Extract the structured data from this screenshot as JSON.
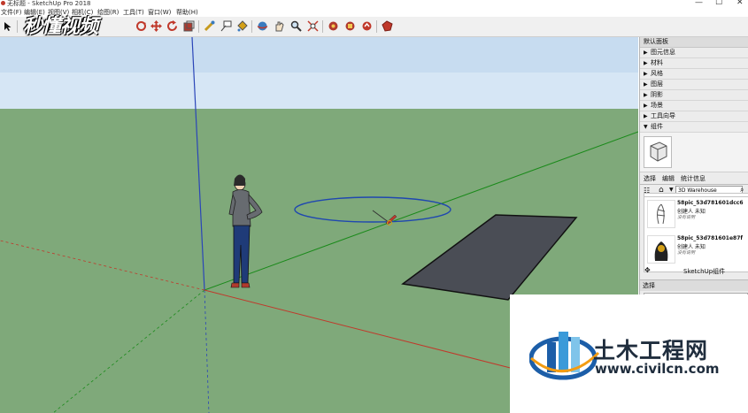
{
  "window": {
    "title": "无标题 - SketchUp Pro 2018",
    "controls": [
      "—",
      "☐",
      "✕"
    ]
  },
  "menu": [
    "文件(F)",
    "编辑(E)",
    "视图(V)",
    "相机(C)",
    "绘图(R)",
    "工具(T)",
    "窗口(W)",
    "帮助(H)"
  ],
  "watermark": "秒懂视频",
  "panel": {
    "title": "默认面板",
    "trays": [
      "图元信息",
      "材料",
      "风格",
      "图层",
      "阴影",
      "场景",
      "工具向导",
      "组件"
    ],
    "tabs": [
      "选择",
      "编辑",
      "统计信息"
    ],
    "search_value": "3D Warehouse",
    "components": [
      {
        "name": "58pic_53d781601dcc6",
        "author": "创建人 未知",
        "desc": "没有说明"
      },
      {
        "name": "58pic_53d781601e87f",
        "author": "创建人 未知",
        "desc": "没有说明"
      }
    ],
    "sketchup_components": "SketchUp组件",
    "bottom_label": "选择"
  },
  "logo": {
    "name": "土木工程网",
    "url": "www.civilcn.com"
  },
  "colors": {
    "sky": "#d6e6f5",
    "ground": "#7fa97a",
    "accent_blue": "#1c5ea8"
  }
}
